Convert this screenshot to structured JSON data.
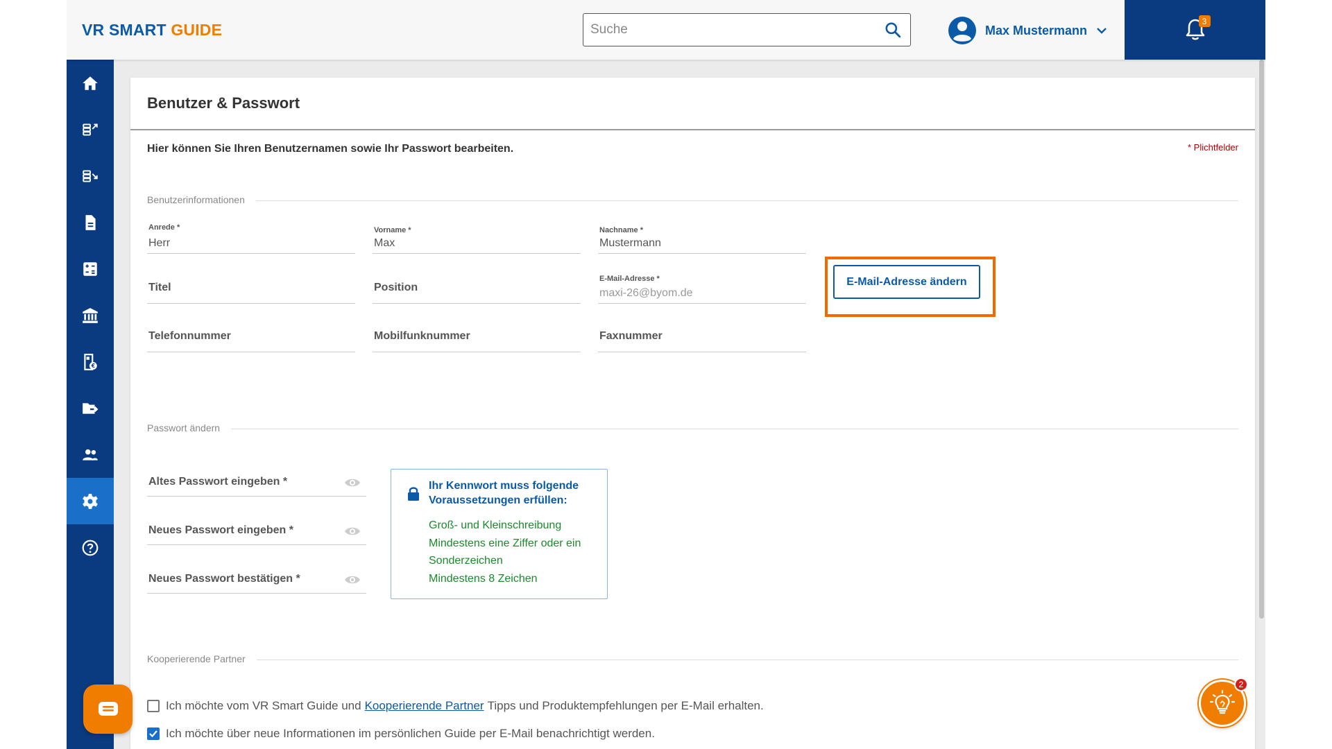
{
  "header": {
    "logo_part1": "VR SMART",
    "logo_part2": "GUIDE",
    "search_placeholder": "Suche",
    "user_name": "Max Mustermann",
    "notification_count": "3"
  },
  "sidebar": {
    "items": [
      {
        "icon": "home-icon"
      },
      {
        "icon": "transfer-out-icon"
      },
      {
        "icon": "transfer-in-icon"
      },
      {
        "icon": "document-icon"
      },
      {
        "icon": "calculator-icon"
      },
      {
        "icon": "bank-icon"
      },
      {
        "icon": "contract-icon"
      },
      {
        "icon": "folder-share-icon"
      },
      {
        "icon": "users-icon"
      },
      {
        "icon": "settings-icon",
        "active": true
      },
      {
        "icon": "help-icon"
      }
    ]
  },
  "page": {
    "title": "Benutzer & Passwort",
    "intro": "Hier können Sie Ihren Benutzernamen sowie Ihr Passwort bearbeiten.",
    "required_note": "* Plichtfelder",
    "section_user": "Benutzerinformationen",
    "section_password": "Passwort ändern",
    "section_partner": "Kooperierende Partner"
  },
  "user_fields": {
    "anrede_label": "Anrede *",
    "anrede_value": "Herr",
    "vorname_label": "Vorname *",
    "vorname_value": "Max",
    "nachname_label": "Nachname *",
    "nachname_value": "Mustermann",
    "titel": "Titel",
    "position": "Position",
    "email_label": "E-Mail-Adresse *",
    "email_value": "maxi-26@byom.de",
    "telefon": "Telefonnummer",
    "mobil": "Mobilfunknummer",
    "fax": "Faxnummer",
    "email_change_button": "E-Mail-Adresse ändern"
  },
  "password": {
    "old": "Altes Passwort eingeben *",
    "new": "Neues Passwort eingeben *",
    "confirm": "Neues Passwort bestätigen *",
    "req_title": "Ihr Kennwort muss folgende Voraussetzungen erfüllen:",
    "rule1": "Groß- und Kleinschreibung",
    "rule2": "Mindestens eine Ziffer oder ein Sonderzeichen",
    "rule3": "Mindestens 8 Zeichen"
  },
  "partner": {
    "cb1_before": "Ich möchte vom VR Smart Guide und",
    "cb1_link": "Kooperierende Partner",
    "cb1_after": "Tipps und Produktempfehlungen per E-Mail erhalten.",
    "cb1_checked": false,
    "cb2": "Ich möchte über neue Informationen im persönlichen Guide per E-Mail benachrichtigt werden.",
    "cb2_checked": true
  },
  "tips_badge": "2",
  "colors": {
    "primary": "#0a5aa8",
    "sidebar": "#0a3a7f",
    "accent": "#f07d00",
    "success": "#1a8a2a",
    "highlight": "#f06a00"
  }
}
